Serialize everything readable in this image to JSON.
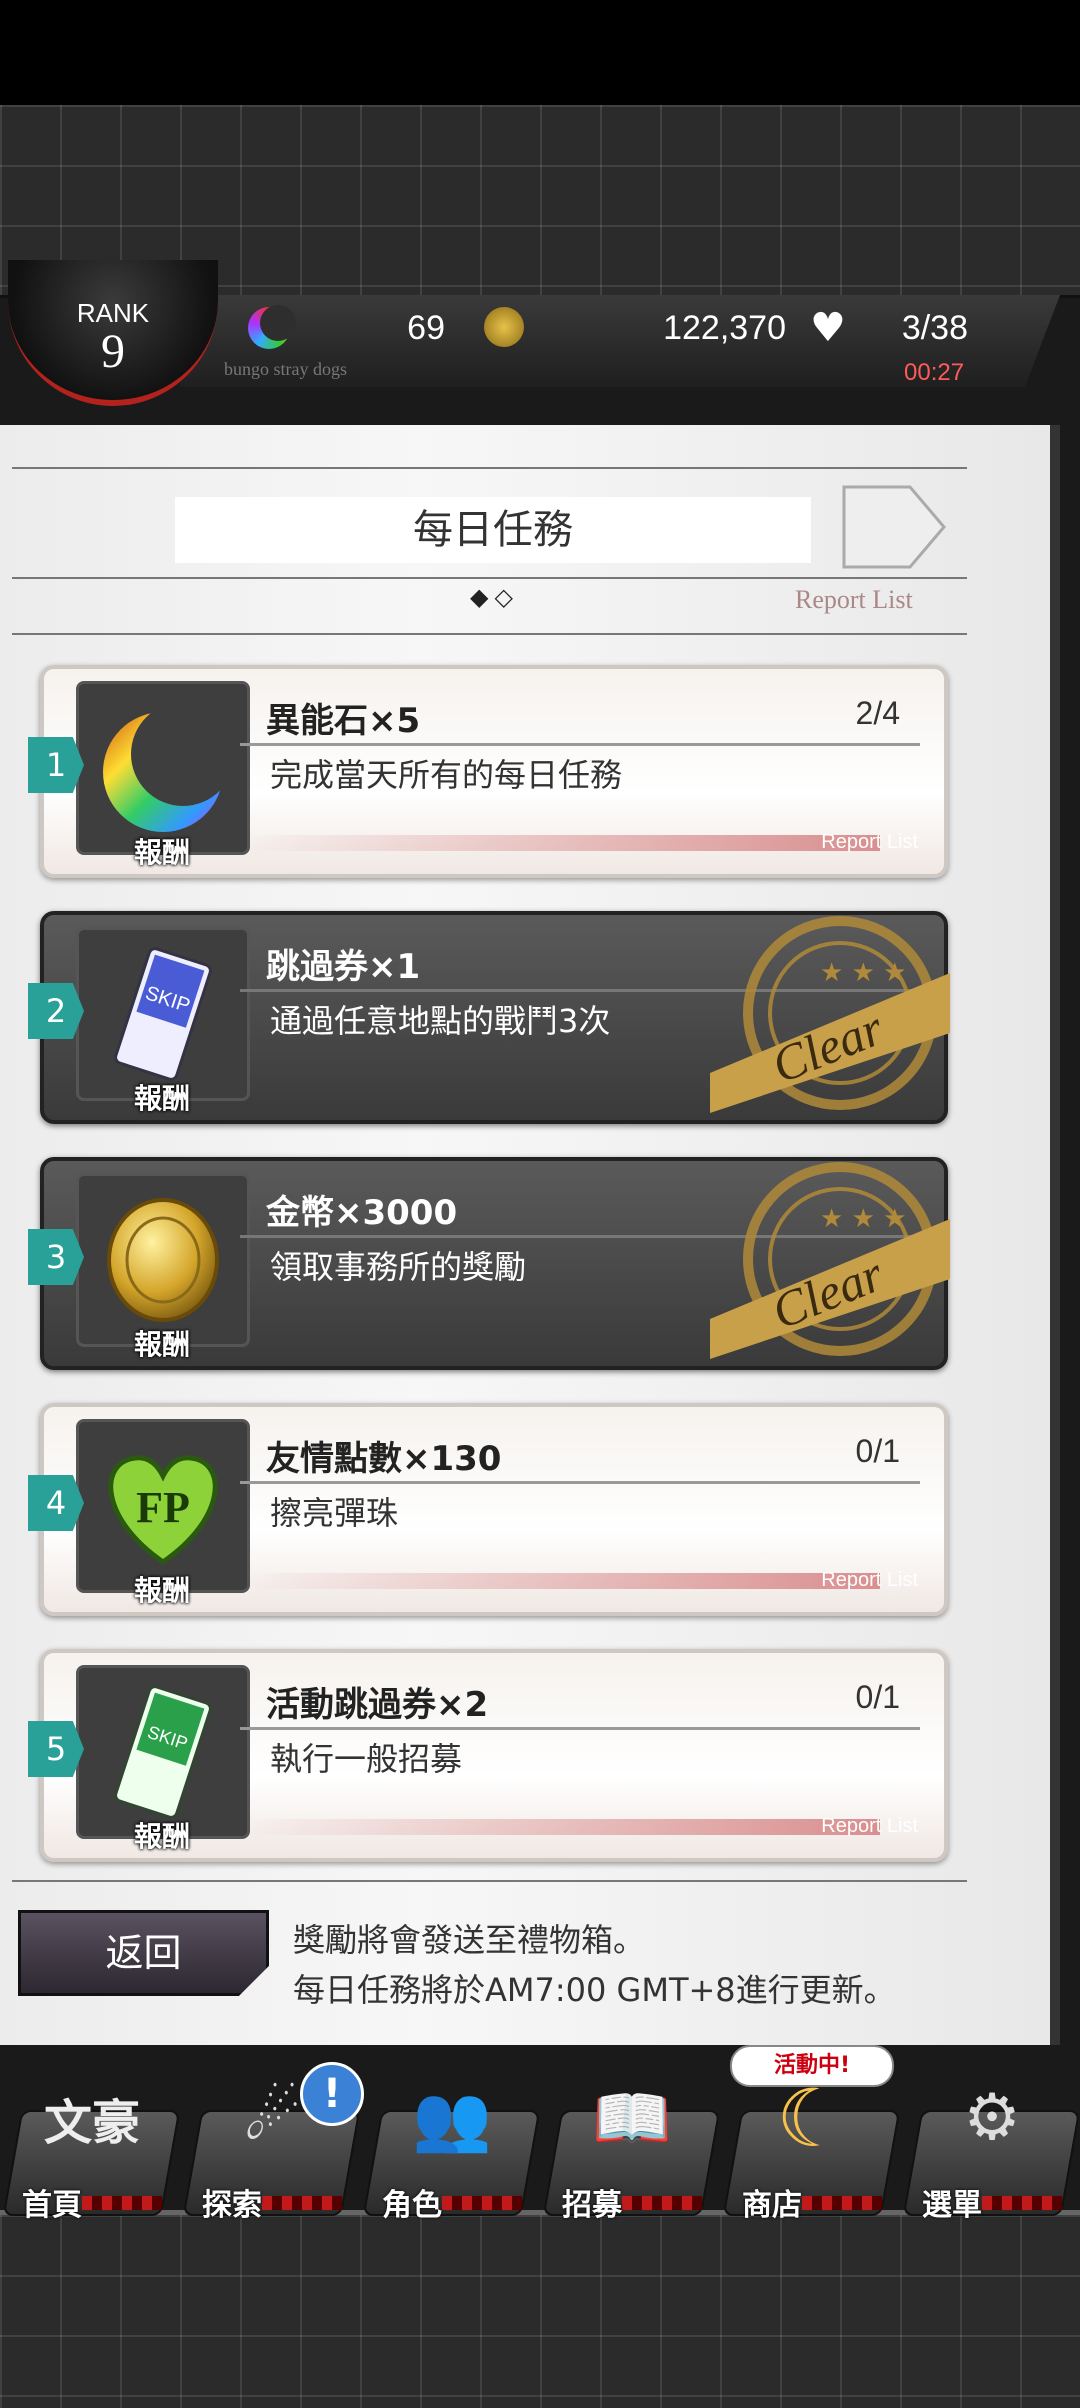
{
  "status": {
    "rank_label": "RANK",
    "rank_value": "9",
    "stones": "69",
    "coins": "122,370",
    "ap": "3/38",
    "subtitle": "bungo stray dogs",
    "timer": "00:27"
  },
  "panel": {
    "title": "每日任務",
    "page_dots": "◆◇",
    "report_list": "Report List"
  },
  "missions": [
    {
      "number": "1",
      "title": "異能石×5",
      "desc": "完成當天所有的每日任務",
      "progress": "2/4",
      "reward_label": "報酬",
      "report": "Report List",
      "state": "open",
      "icon": "rainbow-crescent-stone-icon"
    },
    {
      "number": "2",
      "title": "跳過券×1",
      "desc": "通過任意地點的戰鬥3次",
      "progress": "",
      "reward_label": "報酬",
      "report": "",
      "state": "cleared",
      "stamp": "Clear",
      "icon": "skip-ticket-icon"
    },
    {
      "number": "3",
      "title": "金幣×3000",
      "desc": "領取事務所的獎勵",
      "progress": "",
      "reward_label": "報酬",
      "report": "",
      "state": "cleared",
      "stamp": "Clear",
      "icon": "gold-coin-icon"
    },
    {
      "number": "4",
      "title": "友情點數×130",
      "desc": "擦亮彈珠",
      "progress": "0/1",
      "reward_label": "報酬",
      "report": "Report List",
      "state": "open",
      "icon": "fp-heart-icon"
    },
    {
      "number": "5",
      "title": "活動跳過券×2",
      "desc": "執行一般招募",
      "progress": "0/1",
      "reward_label": "報酬",
      "report": "Report List",
      "state": "open",
      "icon": "event-skip-ticket-icon"
    }
  ],
  "footer": {
    "back_label": "返回",
    "notice_line1": "獎勵將會發送至禮物箱。",
    "notice_line2": "每日任務將於AM7:00 GMT+8進行更新。"
  },
  "nav": {
    "items": [
      {
        "label": "首頁",
        "icon": "home-icon",
        "glyph": "文豪"
      },
      {
        "label": "探索",
        "icon": "explore-icon",
        "glyph": "☄"
      },
      {
        "label": "角色",
        "icon": "characters-icon",
        "glyph": "👥"
      },
      {
        "label": "招募",
        "icon": "recruit-book-icon",
        "glyph": "📖"
      },
      {
        "label": "商店",
        "icon": "shop-stone-icon",
        "glyph": "☾"
      },
      {
        "label": "選單",
        "icon": "menu-gear-icon",
        "glyph": "⚙"
      }
    ],
    "explore_badge": "!",
    "event_bubble": "活動中!"
  },
  "colors": {
    "accent_teal": "#2aa198",
    "timer_red": "#ff5a5a",
    "badge_blue": "#3b82d6"
  }
}
